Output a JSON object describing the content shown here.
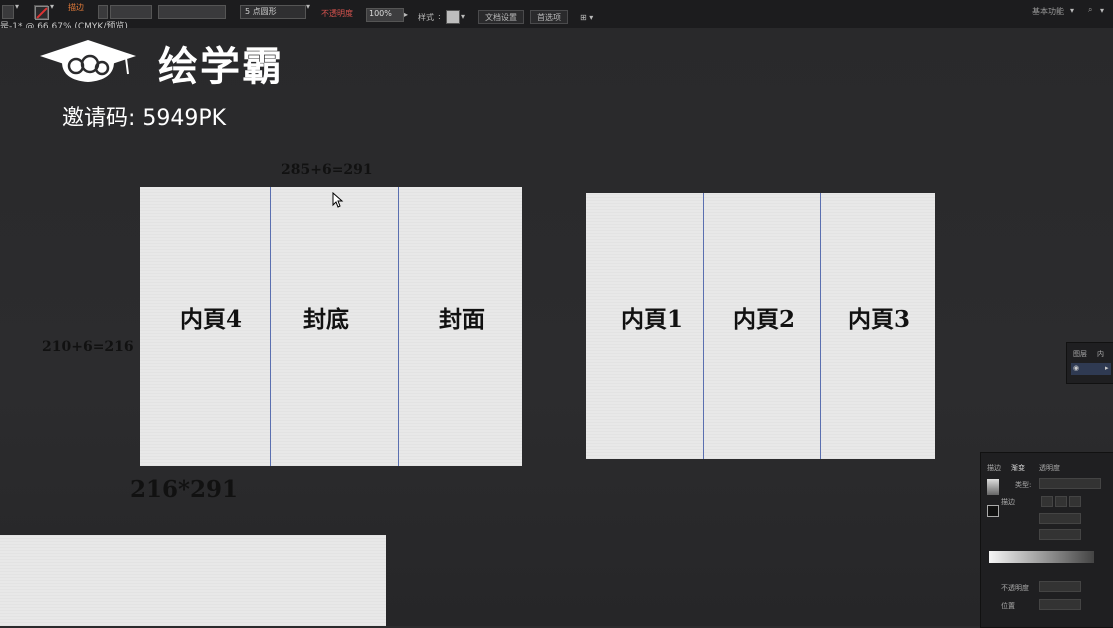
{
  "toolbar": {
    "stroke_label": "描边",
    "stroke_value": "",
    "brush_label": "5 点圆形",
    "opacity_label": "不透明度",
    "opacity_value": "100%",
    "style_label": "样式",
    "doc_setup_button": "文档设置",
    "prefs_button": "首选项",
    "search_placeholder": "",
    "workspace_label": "基本功能"
  },
  "document_tab": "是-1* @ 66.67% (CMYK/预览)",
  "watermark": {
    "brand": "绘学霸",
    "invite": "邀请码: 5949PK"
  },
  "artboards": {
    "front": {
      "width_note": "285+6=291",
      "height_note": "210+6=216",
      "size_note": "216*291",
      "panels": [
        "内頁4",
        "封底",
        "封面"
      ]
    },
    "back": {
      "panels": [
        "内頁1",
        "内頁2",
        "内頁3"
      ]
    }
  },
  "layers_panel": {
    "tab1": "图层",
    "tab2": "内"
  },
  "gradient_panel": {
    "tab1": "描边",
    "tab2": "渐变",
    "tab3": "透明度",
    "type_label": "类型:",
    "stroke_label": "描边",
    "opacity_label": "不透明度",
    "position_label": "位置"
  },
  "colors": {
    "toolbar_bg": "#1c1c1e",
    "canvas_bg": "#2b2b2d",
    "sheet_bg": "#e8e8e8",
    "fold_line": "#5a6fb0",
    "opacity_label_accent": "#d9534f"
  }
}
